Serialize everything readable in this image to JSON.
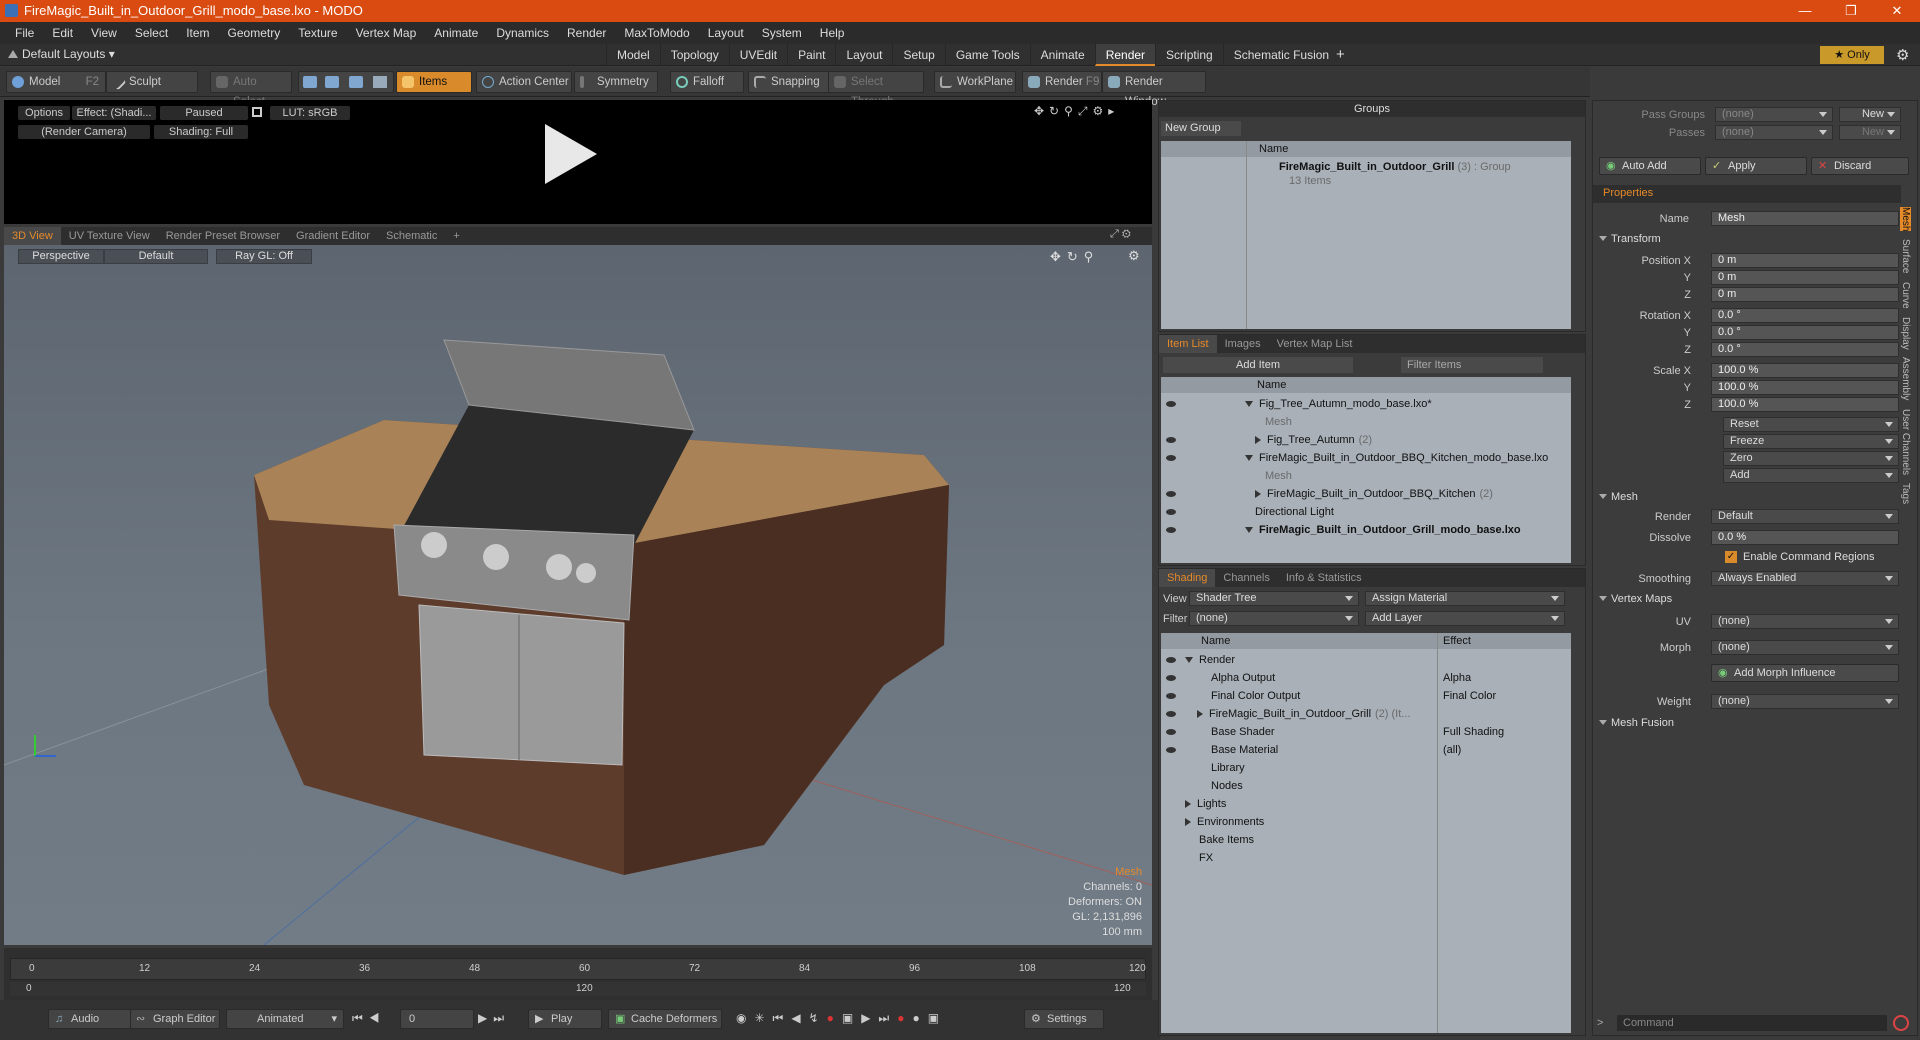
{
  "window": {
    "title": "FireMagic_Built_in_Outdoor_Grill_modo_base.lxo - MODO"
  },
  "menu": [
    "File",
    "Edit",
    "View",
    "Select",
    "Item",
    "Geometry",
    "Texture",
    "Vertex Map",
    "Animate",
    "Dynamics",
    "Render",
    "MaxToModo",
    "Layout",
    "System",
    "Help"
  ],
  "layouts": {
    "label": "Default Layouts",
    "tabs": [
      "Model",
      "Topology",
      "UVEdit",
      "Paint",
      "Layout",
      "Setup",
      "Game Tools",
      "Animate",
      "Render",
      "Scripting",
      "Schematic Fusion"
    ],
    "active": "Render",
    "plus": "+",
    "only": "Only"
  },
  "toolbar": {
    "model": "Model",
    "model_key": "F2",
    "sculpt": "Sculpt",
    "auto_select": "Auto Select",
    "items": "Items",
    "action_center": "Action Center",
    "symmetry": "Symmetry",
    "falloff": "Falloff",
    "snapping": "Snapping",
    "select_through": "Select Through",
    "workplane": "WorkPlane",
    "render": "Render",
    "render_key": "F9",
    "render_window": "Render Window"
  },
  "render_preview": {
    "options": "Options",
    "effect": "Effect: (Shadi...",
    "paused": "Paused",
    "lut": "LUT: sRGB",
    "camera": "(Render Camera)",
    "shading": "Shading: Full"
  },
  "viewport_tabs": {
    "items": [
      "3D View",
      "UV Texture View",
      "Render Preset Browser",
      "Gradient Editor",
      "Schematic"
    ],
    "active": "3D View",
    "plus": "+"
  },
  "viewport": {
    "perspective": "Perspective",
    "default": "Default",
    "raygl": "Ray GL: Off",
    "info": {
      "mesh": "Mesh",
      "channels": "Channels: 0",
      "deformers": "Deformers: ON",
      "gl": "GL: 2,131,896",
      "scale": "100 mm"
    },
    "colors": {
      "accent": "#e58a2a"
    }
  },
  "timeline": {
    "ticks": [
      "0",
      "12",
      "24",
      "36",
      "48",
      "60",
      "72",
      "84",
      "96",
      "108",
      "120"
    ],
    "sub_ticks": [
      "0",
      "120",
      "120"
    ]
  },
  "bottom": {
    "audio": "Audio",
    "graph_editor": "Graph Editor",
    "animated": "Animated",
    "frame": "0",
    "play": "Play",
    "cache": "Cache Deformers",
    "settings": "Settings"
  },
  "groups": {
    "title": "Groups",
    "new_group": "New Group",
    "col_name": "Name",
    "item_name": "FireMagic_Built_in_Outdoor_Grill",
    "item_count": "(3) : Group",
    "item_sub": "13 Items"
  },
  "itemlist": {
    "tabs": [
      "Item List",
      "Images",
      "Vertex Map List"
    ],
    "active": "Item List",
    "add_item": "Add Item",
    "filter": "Filter Items",
    "col_name": "Name",
    "rows": [
      {
        "name": "Fig_Tree_Autumn_modo_base.lxo*",
        "extra": "",
        "indent": 0,
        "tri": "down",
        "dim": false,
        "bold": false
      },
      {
        "name": "Mesh",
        "extra": "",
        "indent": 2,
        "tri": "",
        "dim": true,
        "bold": false
      },
      {
        "name": "Fig_Tree_Autumn",
        "extra": "(2)",
        "indent": 1,
        "tri": "right",
        "dim": false,
        "bold": false
      },
      {
        "name": "FireMagic_Built_in_Outdoor_BBQ_Kitchen_modo_base.lxo",
        "extra": "",
        "indent": 0,
        "tri": "down",
        "dim": false,
        "bold": false
      },
      {
        "name": "Mesh",
        "extra": "",
        "indent": 2,
        "tri": "",
        "dim": true,
        "bold": false
      },
      {
        "name": "FireMagic_Built_in_Outdoor_BBQ_Kitchen",
        "extra": "(2)",
        "indent": 1,
        "tri": "right",
        "dim": false,
        "bold": false
      },
      {
        "name": "Directional Light",
        "extra": "",
        "indent": 1,
        "tri": "",
        "dim": false,
        "bold": false
      },
      {
        "name": "FireMagic_Built_in_Outdoor_Grill_modo_base.lxo",
        "extra": "",
        "indent": 0,
        "tri": "down",
        "dim": false,
        "bold": true
      }
    ]
  },
  "shading": {
    "tabs": [
      "Shading",
      "Channels",
      "Info & Statistics"
    ],
    "active": "Shading",
    "view_label": "View",
    "view": "Shader Tree",
    "assign": "Assign Material",
    "filter_label": "Filter",
    "filter": "(none)",
    "add_layer": "Add Layer",
    "col_name": "Name",
    "col_effect": "Effect",
    "rows": [
      {
        "name": "Render",
        "effect": "",
        "indent": 0,
        "tri": "down"
      },
      {
        "name": "Alpha Output",
        "effect": "Alpha",
        "indent": 1,
        "tri": ""
      },
      {
        "name": "Final Color Output",
        "effect": "Final Color",
        "indent": 1,
        "tri": ""
      },
      {
        "name": "FireMagic_Built_in_Outdoor_Grill",
        "effect": "",
        "indent": 1,
        "tri": "right",
        "extra": "(2) (It..."
      },
      {
        "name": "Base Shader",
        "effect": "Full Shading",
        "indent": 1,
        "tri": ""
      },
      {
        "name": "Base Material",
        "effect": "(all)",
        "indent": 1,
        "tri": ""
      },
      {
        "name": "Library",
        "effect": "",
        "indent": 1,
        "tri": ""
      },
      {
        "name": "Nodes",
        "effect": "",
        "indent": 1,
        "tri": ""
      },
      {
        "name": "Lights",
        "effect": "",
        "indent": 0,
        "tri": "right"
      },
      {
        "name": "Environments",
        "effect": "",
        "indent": 0,
        "tri": "right"
      },
      {
        "name": "Bake Items",
        "effect": "",
        "indent": 0,
        "tri": ""
      },
      {
        "name": "FX",
        "effect": "",
        "indent": 0,
        "tri": ""
      }
    ]
  },
  "properties": {
    "pass_groups_label": "Pass Groups",
    "pass_groups": "(none)",
    "passes_label": "Passes",
    "passes": "(none)",
    "new": "New",
    "auto_add": "Auto Add",
    "apply": "Apply",
    "discard": "Discard",
    "tab": "Properties",
    "name_label": "Name",
    "name": "Mesh",
    "transform": "Transform",
    "position_label": "Position X",
    "pos": [
      "0 m",
      "0 m",
      "0 m"
    ],
    "rotation_label": "Rotation X",
    "rot": [
      "0.0 °",
      "0.0 °",
      "0.0 °"
    ],
    "scale_label": "Scale X",
    "scale": [
      "100.0 %",
      "100.0 %",
      "100.0 %"
    ],
    "y": "Y",
    "z": "Z",
    "reset": "Reset",
    "freeze": "Freeze",
    "zero": "Zero",
    "add": "Add",
    "mesh_section": "Mesh",
    "render_label": "Render",
    "render_val": "Default",
    "dissolve_label": "Dissolve",
    "dissolve": "0.0 %",
    "cmd_regions": "Enable Command Regions",
    "smoothing_label": "Smoothing",
    "smoothing": "Always Enabled",
    "vertex_maps": "Vertex Maps",
    "uv_label": "UV",
    "uv": "(none)",
    "morph_label": "Morph",
    "morph": "(none)",
    "add_morph": "Add Morph Influence",
    "weight_label": "Weight",
    "weight": "(none)",
    "mesh_fusion": "Mesh Fusion",
    "vtabs": [
      "Mesh",
      "Surface",
      "Curve",
      "Display",
      "Assembly",
      "User Channels",
      "Tags"
    ],
    "command": "Command"
  }
}
